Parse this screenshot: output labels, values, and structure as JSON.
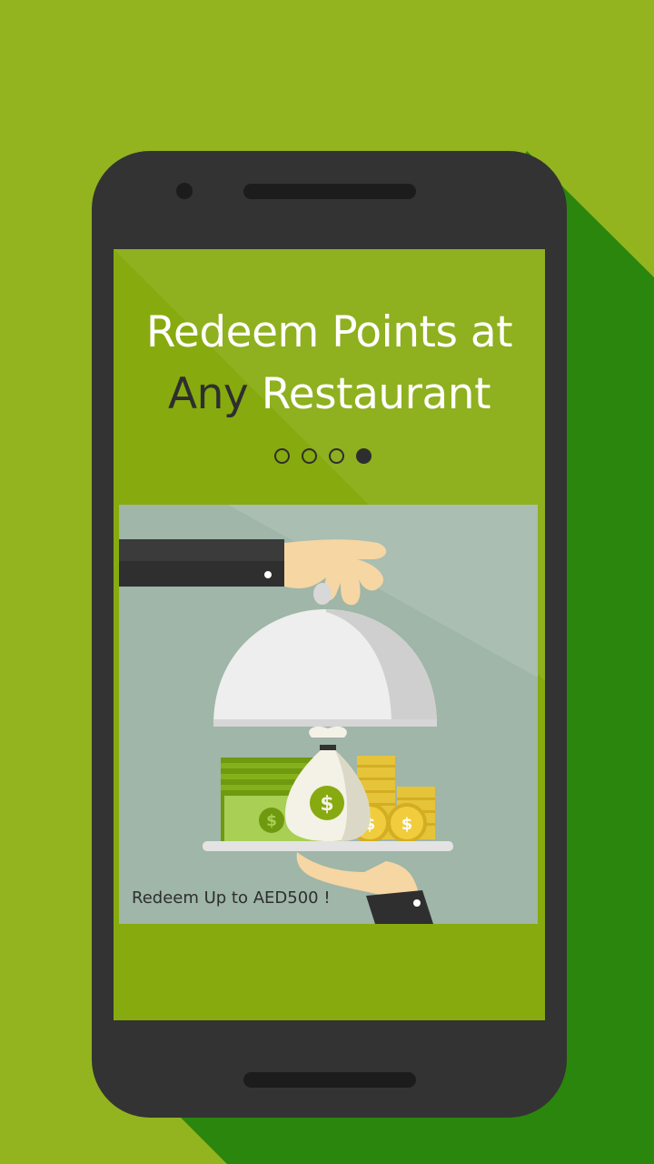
{
  "headline": {
    "line1": "Redeem Points at",
    "line2_dark": "Any",
    "line2_rest": " Restaurant"
  },
  "pager": {
    "total": 4,
    "active_index": 3
  },
  "illustration": {
    "caption": "Redeem Up to AED500 !",
    "icons": [
      "waiter-hand-icon",
      "serving-cloche-icon",
      "money-bag-icon",
      "banknotes-icon",
      "coin-stack-icon",
      "serving-tray-icon"
    ]
  },
  "colors": {
    "background": "#93b41f",
    "shadow": "#2a860c",
    "phone": "#333333",
    "screen": "#87aa0e",
    "illustration_bg": "#9fb6a8"
  }
}
